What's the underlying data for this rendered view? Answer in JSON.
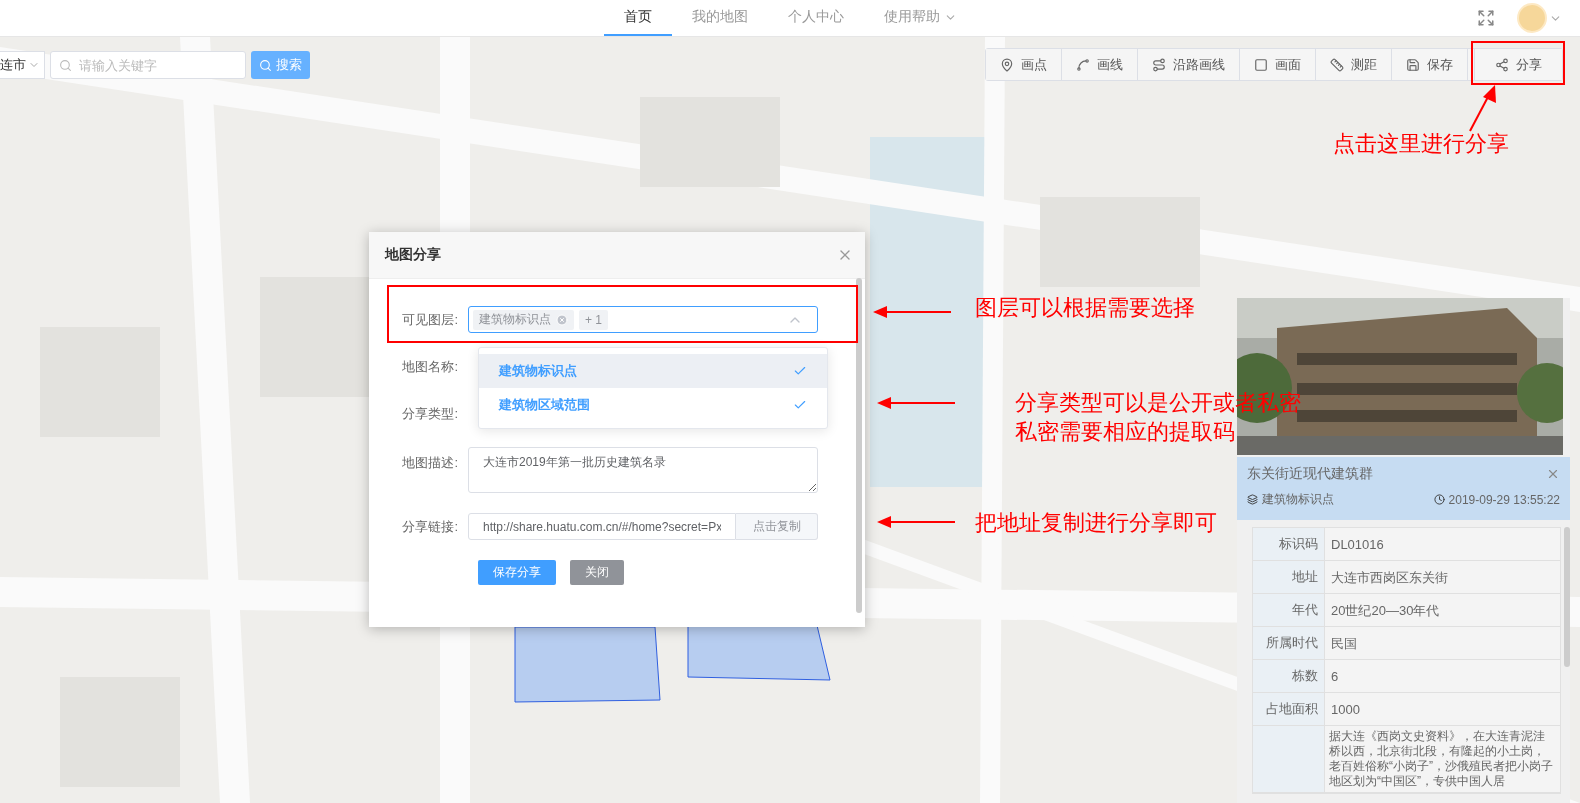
{
  "nav": {
    "tabs": [
      {
        "label": "首页",
        "selected": true,
        "kind": "link"
      },
      {
        "label": "我的地图",
        "selected": false,
        "kind": "link"
      },
      {
        "label": "个人中心",
        "selected": false,
        "kind": "link"
      },
      {
        "label": "使用帮助",
        "selected": false,
        "kind": "menu"
      }
    ]
  },
  "search": {
    "city": "连市",
    "placeholder": "请输入关键字",
    "button": "搜索"
  },
  "toolbar": [
    {
      "label": "画点"
    },
    {
      "label": "画线"
    },
    {
      "label": "沿路画线"
    },
    {
      "label": "画面"
    },
    {
      "label": "测距"
    },
    {
      "label": "保存"
    },
    {
      "label": "分享"
    }
  ],
  "dialog": {
    "title": "地图分享",
    "fields": [
      {
        "kind": "multiselect",
        "label": "可见图层:",
        "tags": [
          "建筑物标识点"
        ],
        "more": "+ 1",
        "expanded": true,
        "options": [
          {
            "label": "建筑物标识点",
            "selected": true,
            "hovered": true
          },
          {
            "label": "建筑物区域范围",
            "selected": true,
            "hovered": false
          }
        ]
      },
      {
        "kind": "covered",
        "label": "地图名称:"
      },
      {
        "kind": "covered",
        "label": "分享类型:"
      },
      {
        "kind": "textarea",
        "label": "地图描述:",
        "value": "大连市2019年第一批历史建筑名录"
      },
      {
        "kind": "link",
        "label": "分享链接:",
        "value": "http://share.huatu.com.cn/#/home?secret=Px",
        "button": "点击复制"
      }
    ],
    "buttons": [
      {
        "label": "保存分享",
        "kind": "primary"
      },
      {
        "label": "关闭",
        "kind": "secondary"
      }
    ]
  },
  "annotations": [
    {
      "lines": [
        "点击这里进行分享"
      ]
    },
    {
      "lines": [
        "图层可以根据需要选择"
      ]
    },
    {
      "lines": [
        "分享类型可以是公开或者私密",
        "私密需要相应的提取码"
      ]
    },
    {
      "lines": [
        "把地址复制进行分享即可"
      ]
    }
  ],
  "info": {
    "title": "东关街近现代建筑群",
    "layer": "建筑物标识点",
    "time": "2019-09-29 13:55:22",
    "rows": [
      {
        "label": "标识码",
        "value": "DL01016"
      },
      {
        "label": "地址",
        "value": "大连市西岗区东关街"
      },
      {
        "label": "年代",
        "value": "20世纪20—30年代"
      },
      {
        "label": "所属时代",
        "value": "民国"
      },
      {
        "label": "栋数",
        "value": "6"
      },
      {
        "label": "占地面积",
        "value": "1000"
      },
      {
        "value": "据大连《西岗文史资料》，在大连青泥洼桥以西，北京街北段，有隆起的小土岗，老百姓俗称“小岗子”，沙俄殖民者把小岗子地区划为“中国区”，专供中国人居"
      }
    ]
  }
}
